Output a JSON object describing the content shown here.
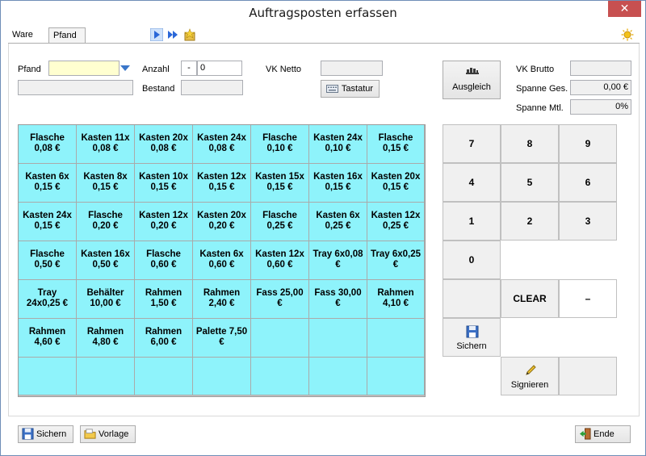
{
  "window": {
    "title": "Auftragsposten erfassen",
    "close_label": "✕"
  },
  "tabs": [
    {
      "label": "Ware"
    },
    {
      "label": "Pfand"
    }
  ],
  "form": {
    "pfand_label": "Pfand",
    "anzahl_label": "Anzahl",
    "anzahl_sign": "-",
    "anzahl_value": "0",
    "bestand_label": "Bestand",
    "vk_netto_label": "VK Netto",
    "tastatur_label": "Tastatur",
    "ausgleich_label": "Ausgleich",
    "vk_brutto_label": "VK Brutto",
    "spanne_ges_label": "Spanne Ges.",
    "spanne_ges_value": "0,00 €",
    "spanne_mtl_label": "Spanne Mtl.",
    "spanne_mtl_value": "0%"
  },
  "pfand_grid": [
    [
      "Flasche\n0,08 €",
      "Kasten 11x\n0,08 €",
      "Kasten 20x\n0,08 €",
      "Kasten 24x\n0,08 €",
      "Flasche\n0,10 €",
      "Kasten 24x\n0,10 €",
      "Flasche\n0,15 €"
    ],
    [
      "Kasten 6x\n0,15 €",
      "Kasten 8x\n0,15 €",
      "Kasten 10x\n0,15 €",
      "Kasten 12x\n0,15 €",
      "Kasten 15x\n0,15 €",
      "Kasten 16x\n0,15 €",
      "Kasten 20x\n0,15 €"
    ],
    [
      "Kasten 24x\n0,15 €",
      "Flasche\n0,20 €",
      "Kasten 12x\n0,20 €",
      "Kasten 20x\n0,20 €",
      "Flasche\n0,25 €",
      "Kasten 6x\n0,25 €",
      "Kasten 12x\n0,25 €"
    ],
    [
      "Flasche\n0,50 €",
      "Kasten 16x\n0,50 €",
      "Flasche\n0,60 €",
      "Kasten 6x\n0,60 €",
      "Kasten 12x\n0,60 €",
      "Tray 6x0,08\n€",
      "Tray 6x0,25\n€"
    ],
    [
      "Tray\n24x0,25 €",
      "Behälter\n10,00 €",
      "Rahmen\n1,50 €",
      "Rahmen\n2,40 €",
      "Fass 25,00\n€",
      "Fass 30,00\n€",
      "Rahmen\n4,10 €"
    ],
    [
      "Rahmen\n4,60 €",
      "Rahmen\n4,80 €",
      "Rahmen\n6,00 €",
      "Palette 7,50\n€",
      "",
      "",
      ""
    ],
    [
      "",
      "",
      "",
      "",
      "",
      "",
      ""
    ]
  ],
  "keypad": {
    "k7": "7",
    "k8": "8",
    "k9": "9",
    "k4": "4",
    "k5": "5",
    "k6": "6",
    "k1": "1",
    "k2": "2",
    "k3": "3",
    "k0": "0",
    "clear": "CLEAR",
    "minus": "–",
    "sichern": "Sichern",
    "signieren": "Signieren"
  },
  "footer": {
    "sichern": "Sichern",
    "vorlage": "Vorlage",
    "ende": "Ende"
  }
}
